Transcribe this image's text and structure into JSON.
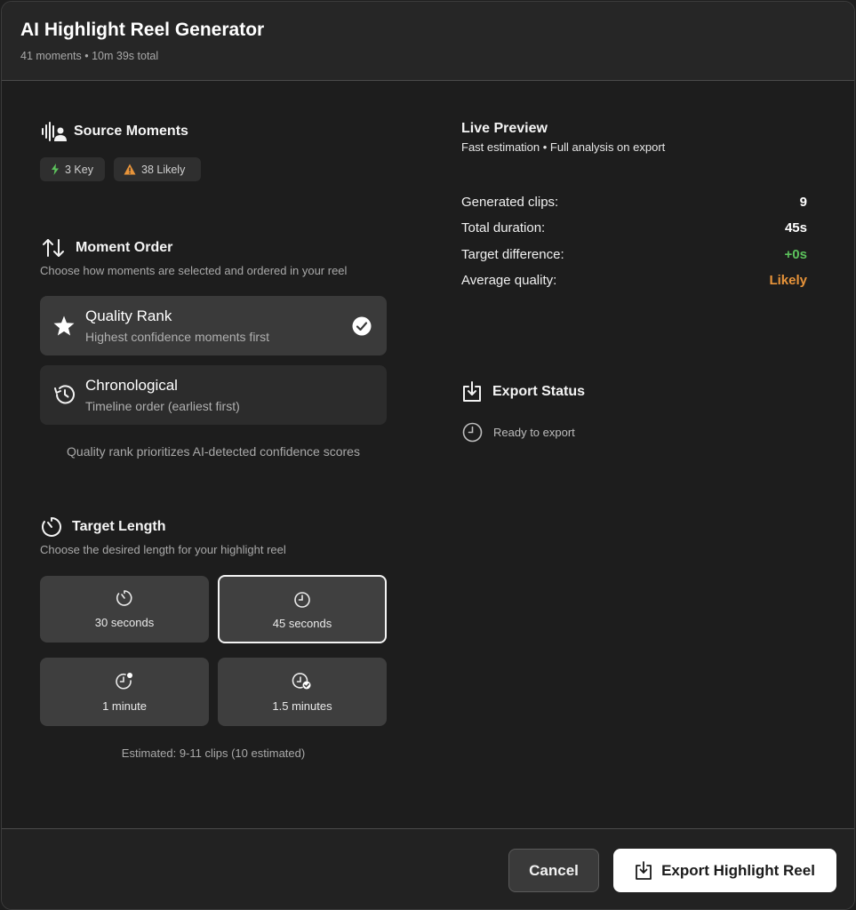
{
  "header": {
    "title": "AI Highlight Reel Generator",
    "subtitle": "41 moments • 10m 39s total"
  },
  "source": {
    "title": "Source Moments",
    "chips": [
      {
        "label": "3 Key",
        "icon": "lightning-icon",
        "color": "#5cc25c"
      },
      {
        "label": "38 Likely",
        "icon": "warning-icon",
        "color": "#e8943a"
      }
    ]
  },
  "order": {
    "title": "Moment Order",
    "desc": "Choose how moments are selected and ordered in your reel",
    "options": [
      {
        "title": "Quality Rank",
        "desc": "Highest confidence moments first",
        "icon": "star-icon",
        "selected": true
      },
      {
        "title": "Chronological",
        "desc": "Timeline order (earliest first)",
        "icon": "history-icon",
        "selected": false
      }
    ],
    "note": "Quality rank prioritizes AI-detected confidence scores"
  },
  "target": {
    "title": "Target Length",
    "desc": "Choose the desired length for your highlight reel",
    "options": [
      {
        "label": "30 seconds",
        "icon": "timer-icon",
        "selected": false
      },
      {
        "label": "45 seconds",
        "icon": "clock-icon",
        "selected": true
      },
      {
        "label": "1 minute",
        "icon": "clock-dot-icon",
        "selected": false
      },
      {
        "label": "1.5 minutes",
        "icon": "clock-check-icon",
        "selected": false
      }
    ],
    "estimate": "Estimated: 9-11 clips (10 estimated)"
  },
  "preview": {
    "title": "Live Preview",
    "subtitle": "Fast estimation • Full analysis on export",
    "stats": [
      {
        "label": "Generated clips:",
        "value": "9",
        "color": "#ffffff"
      },
      {
        "label": "Total duration:",
        "value": "45s",
        "color": "#ffffff"
      },
      {
        "label": "Target difference:",
        "value": "+0s",
        "color": "#5cc25c"
      },
      {
        "label": "Average quality:",
        "value": "Likely",
        "color": "#e8943a"
      }
    ]
  },
  "export_status": {
    "title": "Export Status",
    "status": "Ready to export"
  },
  "footer": {
    "cancel": "Cancel",
    "export": "Export Highlight Reel"
  }
}
